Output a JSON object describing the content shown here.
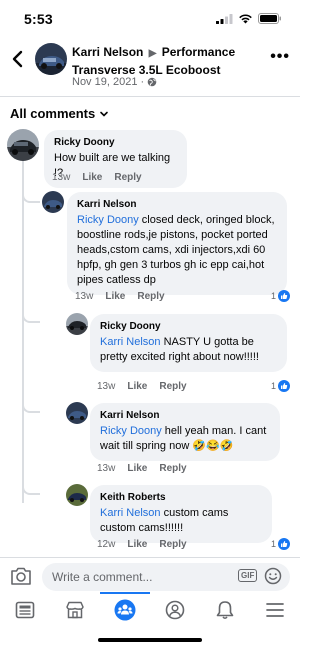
{
  "status_bar": {
    "time": "5:53"
  },
  "header": {
    "author": "Karri Nelson",
    "group": "Performance Transverse 3.5L Ecoboost",
    "date": "Nov 19, 2021 ·"
  },
  "filter": {
    "label": "All comments"
  },
  "comments": [
    {
      "author": "Ricky Doony",
      "mention": "",
      "text": "How built are we talking !?",
      "time": "13w",
      "like": "Like",
      "reply": "Reply",
      "reactions": "",
      "emoji": ""
    },
    {
      "author": "Karri Nelson",
      "mention": "Ricky Doony",
      "text": " closed deck, oringed block, boostline rods,je pistons, pocket ported heads,cstom cams, xdi injectors,xdi 60 hpfp, gh gen 3 turbos gh ic epp cai,hot pipes catless dp",
      "time": "13w",
      "like": "Like",
      "reply": "Reply",
      "reactions": "1",
      "emoji": ""
    },
    {
      "author": "Ricky Doony",
      "mention": "Karri Nelson",
      "text": " NASTY U gotta be pretty excited right about now!!!!!",
      "time": "13w",
      "like": "Like",
      "reply": "Reply",
      "reactions": "1",
      "emoji": ""
    },
    {
      "author": "Karri Nelson",
      "mention": "Ricky Doony",
      "text": " hell yeah man. I cant wait till spring now ",
      "time": "13w",
      "like": "Like",
      "reply": "Reply",
      "reactions": "",
      "emoji": "🤣😂🤣"
    },
    {
      "author": "Keith Roberts",
      "mention": "Karri Nelson",
      "text": " custom cams custom cams!!!!!!",
      "time": "12w",
      "like": "Like",
      "reply": "Reply",
      "reactions": "1",
      "emoji": ""
    }
  ],
  "composer": {
    "placeholder": "Write a comment...",
    "gif": "GIF"
  },
  "nav": [
    {
      "icon": "news-feed-icon"
    },
    {
      "icon": "marketplace-icon"
    },
    {
      "icon": "groups-icon"
    },
    {
      "icon": "profile-icon"
    },
    {
      "icon": "notifications-bell-icon"
    },
    {
      "icon": "menu-icon"
    }
  ],
  "colors": {
    "accent": "#1877f2",
    "mention": "#216fdb",
    "bubble": "#f0f2f5",
    "muted": "#65676b"
  }
}
